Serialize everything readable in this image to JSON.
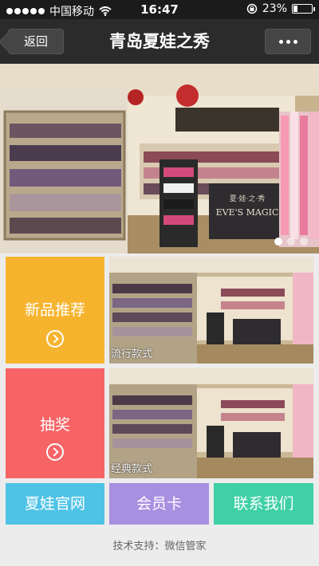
{
  "status_bar": {
    "carrier": "中国移动",
    "time": "16:47",
    "battery_text": "23%",
    "battery_level": 0.23,
    "icons": [
      "signal-dots",
      "wifi-icon",
      "orientation-lock-icon",
      "battery-icon"
    ]
  },
  "nav": {
    "back_label": "返回",
    "title": "青岛夏娃之秀",
    "more_icon": "more-dots-icon"
  },
  "banner": {
    "slide_count": 3,
    "active_slide": 1,
    "sign_text": "EVE'S MAGIC",
    "sign_cn": "夏·娃·之·秀"
  },
  "tiles": {
    "new_products": {
      "label": "新品推荐",
      "color": "#f6b42e",
      "icon": "chevron-right-circle-icon"
    },
    "popular_styles": {
      "caption": "流行款式"
    },
    "lottery": {
      "label": "抽奖",
      "color": "#f76466",
      "icon": "chevron-right-circle-icon"
    },
    "classic_styles": {
      "caption": "经典款式"
    }
  },
  "buttons": {
    "official_site": {
      "label": "夏娃官网",
      "color": "#4fc3e6"
    },
    "member_card": {
      "label": "会员卡",
      "color": "#a98fe0"
    },
    "contact_us": {
      "label": "联系我们",
      "color": "#3fd0a6"
    }
  },
  "footer": {
    "text": "技术支持：微信管家"
  }
}
